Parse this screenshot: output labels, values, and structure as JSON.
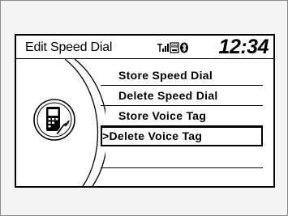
{
  "header": {
    "title": "Edit Speed Dial",
    "clock": "12:34",
    "status_icons": [
      "signal-icon",
      "roaming-icon",
      "bluetooth-icon"
    ]
  },
  "menu": {
    "items": [
      {
        "label": "Store Speed Dial",
        "selected": false
      },
      {
        "label": "Delete Speed Dial",
        "selected": false
      },
      {
        "label": "Store Voice Tag",
        "selected": false
      },
      {
        "label": "Delete Voice Tag",
        "selected": true
      }
    ],
    "cursor": ">"
  },
  "colors": {
    "foreground": "#000000",
    "background": "#ffffff"
  }
}
